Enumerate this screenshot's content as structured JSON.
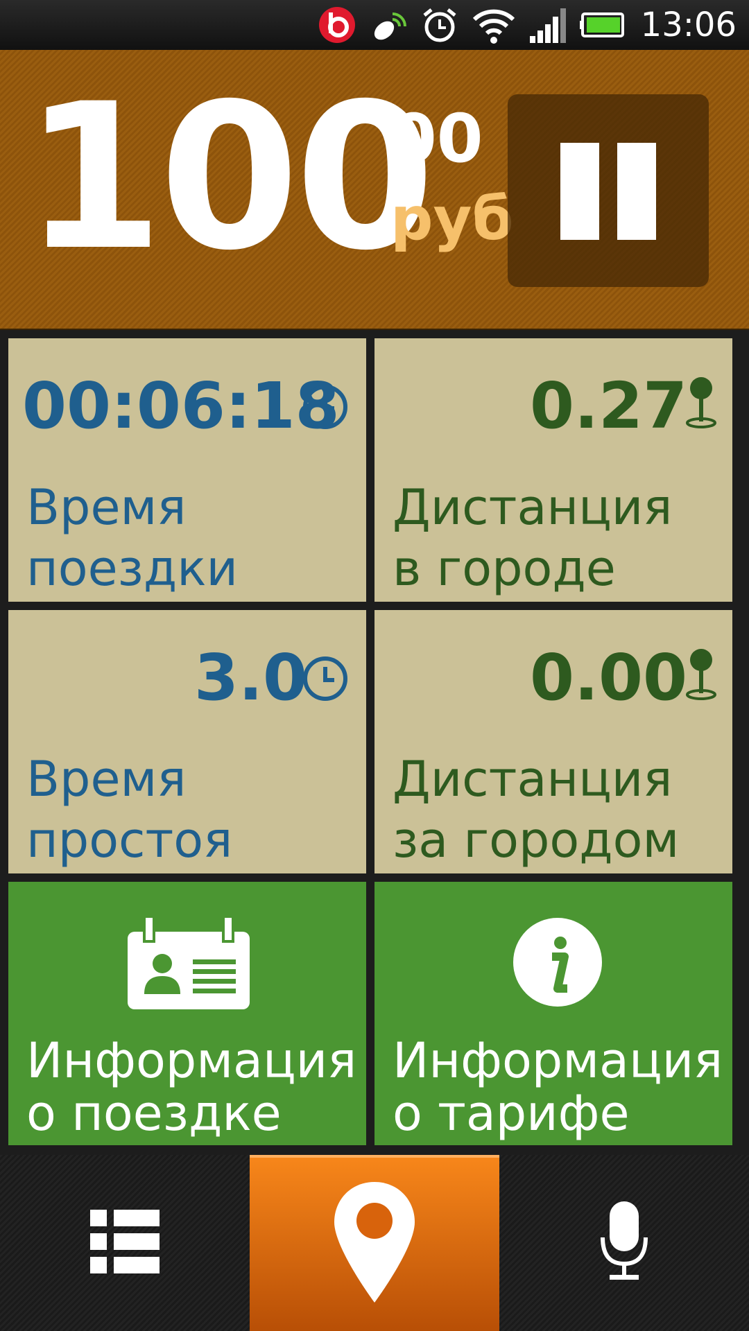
{
  "status_bar": {
    "time": "13:06",
    "icons": [
      "beats-icon",
      "gps-satellite-icon",
      "alarm-clock-icon",
      "wifi-icon",
      "signal-icon",
      "battery-icon"
    ]
  },
  "fare": {
    "integer": "100",
    "decimal": "00",
    "currency": "руб"
  },
  "tiles": {
    "trip_time": {
      "value": "00:06:18",
      "label_line1": "Время",
      "label_line2": "поездки",
      "icon": "clock-icon"
    },
    "city_distance": {
      "value": "0.27",
      "label_line1": "Дистанция",
      "label_line2": "в городе",
      "icon": "map-pin-icon"
    },
    "idle_time": {
      "value": "3.0",
      "label_line1": "Время",
      "label_line2": "простоя",
      "icon": "clock-icon"
    },
    "outside_distance": {
      "value": "0.00",
      "label_line1": "Дистанция",
      "label_line2": "за городом",
      "icon": "map-pin-icon"
    },
    "trip_info": {
      "label_line1": "Информация",
      "label_line2": "о поездке",
      "icon": "id-card-icon"
    },
    "tariff_info": {
      "label_line1": "Информация",
      "label_line2": "о тарифе",
      "icon": "info-icon"
    }
  },
  "nav": {
    "items": [
      {
        "icon": "list-icon",
        "active": false
      },
      {
        "icon": "location-pin-icon",
        "active": true
      },
      {
        "icon": "microphone-icon",
        "active": false
      }
    ]
  },
  "colors": {
    "fare_bg": "#9a5e10",
    "tile_bg": "#cbc197",
    "tile_green": "#4b9632",
    "text_blue": "#1f5f8e",
    "text_green": "#2e5a1f",
    "currency": "#f6c06b",
    "nav_active": "#f7861a"
  }
}
